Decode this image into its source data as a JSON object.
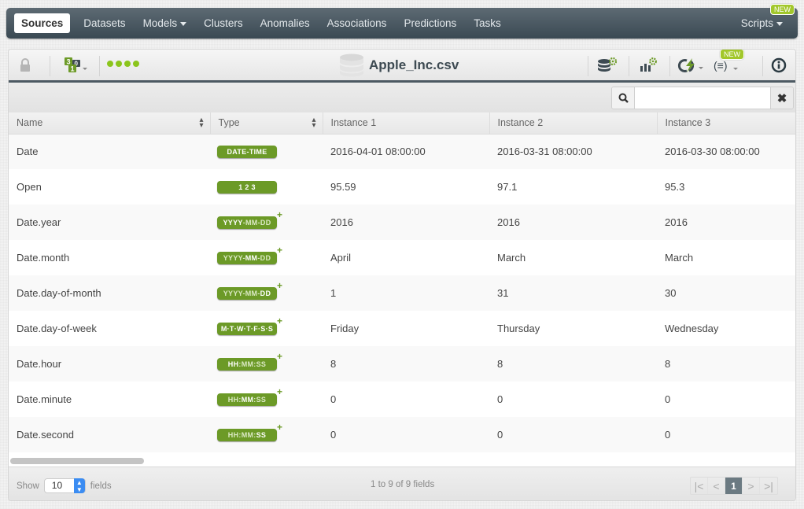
{
  "nav": {
    "items": [
      {
        "label": "Sources",
        "active": true
      },
      {
        "label": "Datasets"
      },
      {
        "label": "Models",
        "dropdown": true
      },
      {
        "label": "Clusters"
      },
      {
        "label": "Anomalies"
      },
      {
        "label": "Associations"
      },
      {
        "label": "Predictions"
      },
      {
        "label": "Tasks"
      }
    ],
    "scripts_label": "Scripts",
    "scripts_badge": "NEW"
  },
  "toolbar": {
    "title": "Apple_Inc.csv",
    "icons": [
      "lock-icon",
      "source-type-icon",
      "status-dots",
      "configure-dataset-icon",
      "configure-model-icon",
      "one-click-icon",
      "scripts-icon",
      "info-icon"
    ],
    "scripts_badge": "NEW",
    "status_dots": 4
  },
  "search": {
    "placeholder": "",
    "value": ""
  },
  "colors": {
    "accent_green": "#6c9a27",
    "nav_dark": "#3a4953",
    "dot_green": "#8bc51c",
    "new_badge": "#a2c72b"
  },
  "table": {
    "headers": [
      "Name",
      "Type",
      "Instance 1",
      "Instance 2",
      "Instance 3"
    ],
    "rows": [
      {
        "name": "Date",
        "type": "datetime",
        "values": [
          "2016-04-01 08:00:00",
          "2016-03-31 08:00:00",
          "2016-03-30 08:00:00"
        ]
      },
      {
        "name": "Open",
        "type": "numeric",
        "values": [
          "95.59",
          "97.1",
          "95.3"
        ]
      },
      {
        "name": "Date.year",
        "type": "year",
        "values": [
          "2016",
          "2016",
          "2016"
        ]
      },
      {
        "name": "Date.month",
        "type": "month",
        "values": [
          "April",
          "March",
          "March"
        ]
      },
      {
        "name": "Date.day-of-month",
        "type": "day-of-month",
        "values": [
          "1",
          "31",
          "30"
        ]
      },
      {
        "name": "Date.day-of-week",
        "type": "day-of-week",
        "values": [
          "Friday",
          "Thursday",
          "Wednesday"
        ]
      },
      {
        "name": "Date.hour",
        "type": "hour",
        "values": [
          "8",
          "8",
          "8"
        ]
      },
      {
        "name": "Date.minute",
        "type": "minute",
        "values": [
          "0",
          "0",
          "0"
        ]
      },
      {
        "name": "Date.second",
        "type": "second",
        "values": [
          "0",
          "0",
          "0"
        ]
      }
    ],
    "badges": {
      "datetime": "DATE-TIME",
      "numeric": "1 2 3",
      "year": [
        "YYYY",
        "-MM-DD"
      ],
      "month": [
        "YYYY-",
        "MM",
        "-DD"
      ],
      "day-of-month": [
        "YYYY-MM-",
        "DD"
      ],
      "day-of-week": "M·T·W·T·F·S·S",
      "hour": [
        "HH",
        ":MM:SS"
      ],
      "minute": [
        "HH:",
        "MM",
        ":SS"
      ],
      "second": [
        "HH:MM:",
        "SS"
      ]
    }
  },
  "footer": {
    "show_label": "Show",
    "page_size": "10",
    "fields_label": "fields",
    "count_text": "1 to 9 of 9 fields",
    "current_page": "1"
  }
}
